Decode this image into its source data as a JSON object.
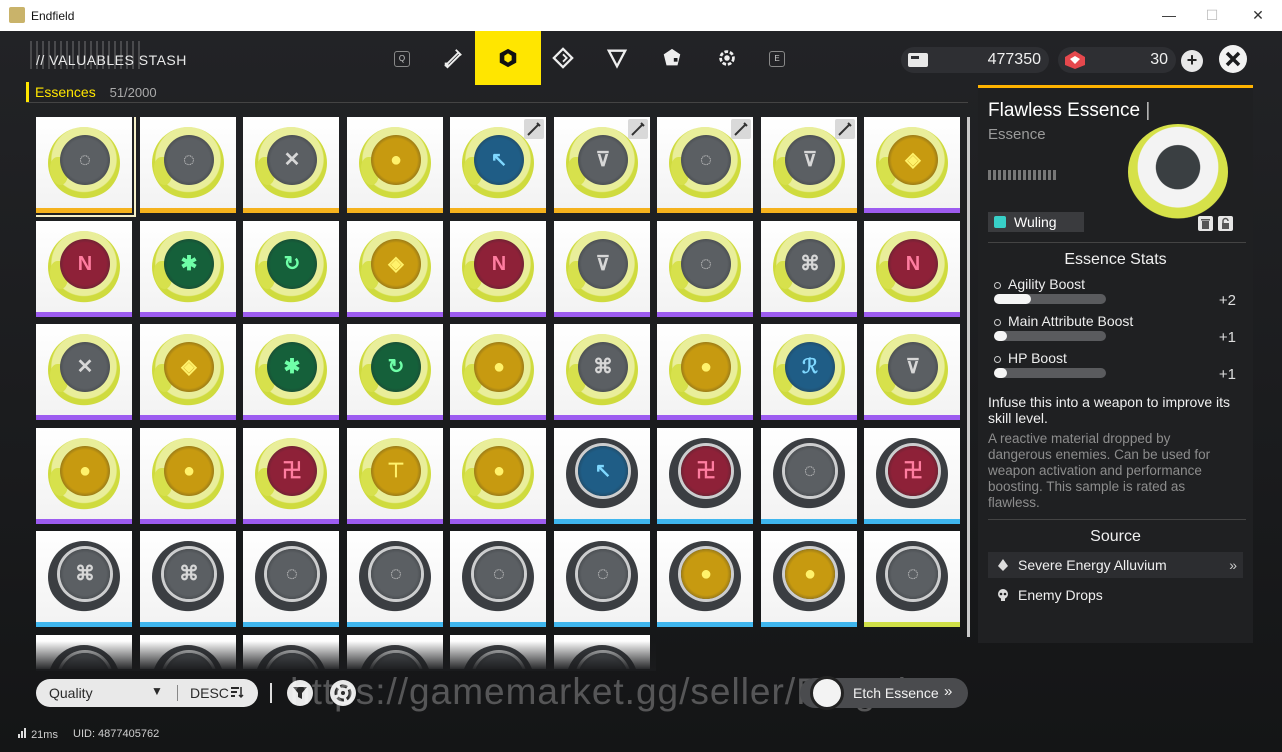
{
  "window": {
    "title": "Endfield",
    "controls": {
      "minimize": "—",
      "maximize": "☐",
      "close": "✕"
    }
  },
  "header": {
    "title": "// VALUABLES STASH",
    "left_key": "Q",
    "right_key": "E",
    "tabs": [
      {
        "icon": "weapon-edit-icon",
        "active": false
      },
      {
        "icon": "essence-cube-icon",
        "active": true
      },
      {
        "icon": "diamond-gem-icon",
        "active": false
      },
      {
        "icon": "triangle-icon",
        "active": false
      },
      {
        "icon": "pentagon-tag-icon",
        "active": false
      },
      {
        "icon": "gear-icon",
        "active": false
      }
    ],
    "currency_primary": {
      "icon": "currency-card-icon",
      "amount": "477350"
    },
    "currency_secondary": {
      "icon": "originium-icon",
      "amount": "30"
    },
    "plus_label": "+",
    "close_icon": "close-x-icon"
  },
  "category": {
    "name": "Essences",
    "count": "51/2000"
  },
  "colors": {
    "accent": "#ffe600",
    "rarity_gold": "#f5b21d",
    "rarity_purple": "#9d5cf0",
    "rarity_blue": "#3fb6ee",
    "rarity_lime": "#d0e048",
    "tag_teal": "#38d0c8"
  },
  "grid_items": [
    {
      "row": 0,
      "col": 0,
      "theme": "yellow",
      "glyph": "◌",
      "face": "grey",
      "rarity": "gold",
      "selected": true,
      "locked": false
    },
    {
      "row": 0,
      "col": 1,
      "theme": "yellow",
      "glyph": "◌",
      "face": "grey",
      "rarity": "gold",
      "selected": false,
      "locked": false
    },
    {
      "row": 0,
      "col": 2,
      "theme": "yellow",
      "glyph": "✕",
      "face": "grey",
      "rarity": "gold",
      "selected": false,
      "locked": false
    },
    {
      "row": 0,
      "col": 3,
      "theme": "yellow",
      "glyph": "●",
      "face": "gold",
      "rarity": "gold",
      "selected": false,
      "locked": false
    },
    {
      "row": 0,
      "col": 4,
      "theme": "yellow",
      "glyph": "↖",
      "face": "blue",
      "rarity": "gold",
      "selected": false,
      "locked": true
    },
    {
      "row": 0,
      "col": 5,
      "theme": "yellow",
      "glyph": "⊽",
      "face": "grey",
      "rarity": "gold",
      "selected": false,
      "locked": true
    },
    {
      "row": 0,
      "col": 6,
      "theme": "yellow",
      "glyph": "◌",
      "face": "grey",
      "rarity": "gold",
      "selected": false,
      "locked": true
    },
    {
      "row": 0,
      "col": 7,
      "theme": "yellow",
      "glyph": "⊽",
      "face": "grey",
      "rarity": "gold",
      "selected": false,
      "locked": true
    },
    {
      "row": 0,
      "col": 8,
      "theme": "yellow",
      "glyph": "◈",
      "face": "gold",
      "rarity": "purple",
      "selected": false,
      "locked": false
    },
    {
      "row": 1,
      "col": 0,
      "theme": "yellow",
      "glyph": "N",
      "face": "red",
      "rarity": "purple",
      "selected": false,
      "locked": false
    },
    {
      "row": 1,
      "col": 1,
      "theme": "yellow",
      "glyph": "✱",
      "face": "green",
      "rarity": "purple",
      "selected": false,
      "locked": false
    },
    {
      "row": 1,
      "col": 2,
      "theme": "yellow",
      "glyph": "↻",
      "face": "green",
      "rarity": "purple",
      "selected": false,
      "locked": false
    },
    {
      "row": 1,
      "col": 3,
      "theme": "yellow",
      "glyph": "◈",
      "face": "gold",
      "rarity": "purple",
      "selected": false,
      "locked": false
    },
    {
      "row": 1,
      "col": 4,
      "theme": "yellow",
      "glyph": "N",
      "face": "red",
      "rarity": "purple",
      "selected": false,
      "locked": false
    },
    {
      "row": 1,
      "col": 5,
      "theme": "yellow",
      "glyph": "⊽",
      "face": "grey",
      "rarity": "purple",
      "selected": false,
      "locked": false
    },
    {
      "row": 1,
      "col": 6,
      "theme": "yellow",
      "glyph": "◌",
      "face": "grey",
      "rarity": "purple",
      "selected": false,
      "locked": false
    },
    {
      "row": 1,
      "col": 7,
      "theme": "yellow",
      "glyph": "⌘",
      "face": "grey",
      "rarity": "purple",
      "selected": false,
      "locked": false
    },
    {
      "row": 1,
      "col": 8,
      "theme": "yellow",
      "glyph": "N",
      "face": "red",
      "rarity": "purple",
      "selected": false,
      "locked": false
    },
    {
      "row": 2,
      "col": 0,
      "theme": "yellow",
      "glyph": "✕",
      "face": "grey",
      "rarity": "purple",
      "selected": false,
      "locked": false
    },
    {
      "row": 2,
      "col": 1,
      "theme": "yellow",
      "glyph": "◈",
      "face": "gold",
      "rarity": "purple",
      "selected": false,
      "locked": false
    },
    {
      "row": 2,
      "col": 2,
      "theme": "yellow",
      "glyph": "✱",
      "face": "green",
      "rarity": "purple",
      "selected": false,
      "locked": false
    },
    {
      "row": 2,
      "col": 3,
      "theme": "yellow",
      "glyph": "↻",
      "face": "green",
      "rarity": "purple",
      "selected": false,
      "locked": false
    },
    {
      "row": 2,
      "col": 4,
      "theme": "yellow",
      "glyph": "●",
      "face": "gold",
      "rarity": "purple",
      "selected": false,
      "locked": false
    },
    {
      "row": 2,
      "col": 5,
      "theme": "yellow",
      "glyph": "⌘",
      "face": "grey",
      "rarity": "purple",
      "selected": false,
      "locked": false
    },
    {
      "row": 2,
      "col": 6,
      "theme": "yellow",
      "glyph": "●",
      "face": "gold",
      "rarity": "purple",
      "selected": false,
      "locked": false
    },
    {
      "row": 2,
      "col": 7,
      "theme": "yellow",
      "glyph": "ℛ",
      "face": "blue",
      "rarity": "purple",
      "selected": false,
      "locked": false
    },
    {
      "row": 2,
      "col": 8,
      "theme": "yellow",
      "glyph": "⊽",
      "face": "grey",
      "rarity": "purple",
      "selected": false,
      "locked": false
    },
    {
      "row": 3,
      "col": 0,
      "theme": "yellow",
      "glyph": "●",
      "face": "gold",
      "rarity": "purple",
      "selected": false,
      "locked": false
    },
    {
      "row": 3,
      "col": 1,
      "theme": "yellow",
      "glyph": "●",
      "face": "gold",
      "rarity": "purple",
      "selected": false,
      "locked": false
    },
    {
      "row": 3,
      "col": 2,
      "theme": "yellow",
      "glyph": "卍",
      "face": "red",
      "rarity": "purple",
      "selected": false,
      "locked": false
    },
    {
      "row": 3,
      "col": 3,
      "theme": "yellow",
      "glyph": "⊤",
      "face": "gold",
      "rarity": "purple",
      "selected": false,
      "locked": false
    },
    {
      "row": 3,
      "col": 4,
      "theme": "yellow",
      "glyph": "●",
      "face": "gold",
      "rarity": "purple",
      "selected": false,
      "locked": false
    },
    {
      "row": 3,
      "col": 5,
      "theme": "dark",
      "glyph": "↖",
      "face": "blue",
      "rarity": "blue",
      "selected": false,
      "locked": false
    },
    {
      "row": 3,
      "col": 6,
      "theme": "dark",
      "glyph": "卍",
      "face": "red",
      "rarity": "blue",
      "selected": false,
      "locked": false
    },
    {
      "row": 3,
      "col": 7,
      "theme": "dark",
      "glyph": "◌",
      "face": "grey",
      "rarity": "blue",
      "selected": false,
      "locked": false
    },
    {
      "row": 3,
      "col": 8,
      "theme": "dark",
      "glyph": "卍",
      "face": "red",
      "rarity": "blue",
      "selected": false,
      "locked": false
    },
    {
      "row": 4,
      "col": 0,
      "theme": "dark",
      "glyph": "⌘",
      "face": "grey",
      "rarity": "blue",
      "selected": false,
      "locked": false
    },
    {
      "row": 4,
      "col": 1,
      "theme": "dark",
      "glyph": "⌘",
      "face": "grey",
      "rarity": "blue",
      "selected": false,
      "locked": false
    },
    {
      "row": 4,
      "col": 2,
      "theme": "dark",
      "glyph": "◌",
      "face": "grey",
      "rarity": "blue",
      "selected": false,
      "locked": false
    },
    {
      "row": 4,
      "col": 3,
      "theme": "dark",
      "glyph": "◌",
      "face": "grey",
      "rarity": "blue",
      "selected": false,
      "locked": false
    },
    {
      "row": 4,
      "col": 4,
      "theme": "dark",
      "glyph": "◌",
      "face": "grey",
      "rarity": "blue",
      "selected": false,
      "locked": false
    },
    {
      "row": 4,
      "col": 5,
      "theme": "dark",
      "glyph": "◌",
      "face": "grey",
      "rarity": "blue",
      "selected": false,
      "locked": false
    },
    {
      "row": 4,
      "col": 6,
      "theme": "dark",
      "glyph": "●",
      "face": "gold",
      "rarity": "blue",
      "selected": false,
      "locked": false
    },
    {
      "row": 4,
      "col": 7,
      "theme": "dark",
      "glyph": "●",
      "face": "gold",
      "rarity": "blue",
      "selected": false,
      "locked": false
    },
    {
      "row": 4,
      "col": 8,
      "theme": "dark",
      "glyph": "◌",
      "face": "grey",
      "rarity": "lime",
      "selected": false,
      "locked": false
    },
    {
      "row": 5,
      "col": 0,
      "theme": "dark",
      "glyph": "",
      "face": "grey",
      "rarity": "none",
      "selected": false,
      "locked": false
    },
    {
      "row": 5,
      "col": 1,
      "theme": "dark",
      "glyph": "",
      "face": "grey",
      "rarity": "none",
      "selected": false,
      "locked": false
    },
    {
      "row": 5,
      "col": 2,
      "theme": "dark",
      "glyph": "",
      "face": "grey",
      "rarity": "none",
      "selected": false,
      "locked": false
    },
    {
      "row": 5,
      "col": 3,
      "theme": "dark",
      "glyph": "",
      "face": "grey",
      "rarity": "none",
      "selected": false,
      "locked": false
    },
    {
      "row": 5,
      "col": 4,
      "theme": "dark",
      "glyph": "",
      "face": "grey",
      "rarity": "none",
      "selected": false,
      "locked": false
    },
    {
      "row": 5,
      "col": 5,
      "theme": "dark",
      "glyph": "",
      "face": "grey",
      "rarity": "none",
      "selected": false,
      "locked": false
    }
  ],
  "detail": {
    "title": "Flawless Essence",
    "cursor": "|",
    "type": "Essence",
    "tag": "Wuling",
    "stats_heading": "Essence Stats",
    "stats": [
      {
        "name": "Agility Boost",
        "value": "+2",
        "level": 0.33
      },
      {
        "name": "Main Attribute Boost",
        "value": "+1",
        "level": 0.12
      },
      {
        "name": "HP Boost",
        "value": "+1",
        "level": 0.12
      }
    ],
    "description": "Infuse this into a weapon to improve its skill level.",
    "flavor": "A reactive material dropped by dangerous enemies. Can be used for weapon activation and performance boosting. This sample is rated as flawless.",
    "source_heading": "Source",
    "sources": [
      {
        "label": "Severe Energy Alluvium",
        "icon": "energy-drop-icon",
        "arrow": "»"
      },
      {
        "label": "Enemy Drops",
        "icon": "skull-icon",
        "arrow": ""
      }
    ]
  },
  "toolbar": {
    "sort_label": "Quality",
    "sort_arrow": "▼",
    "order_label": "DESC",
    "etch_label": "Etch Essence",
    "etch_chevron": "»",
    "separator": "|"
  },
  "watermark": "https://gamemarket.gg/seller/Frog3lmn",
  "footer": {
    "ping": "21ms",
    "uid": "UID: 4877405762"
  }
}
